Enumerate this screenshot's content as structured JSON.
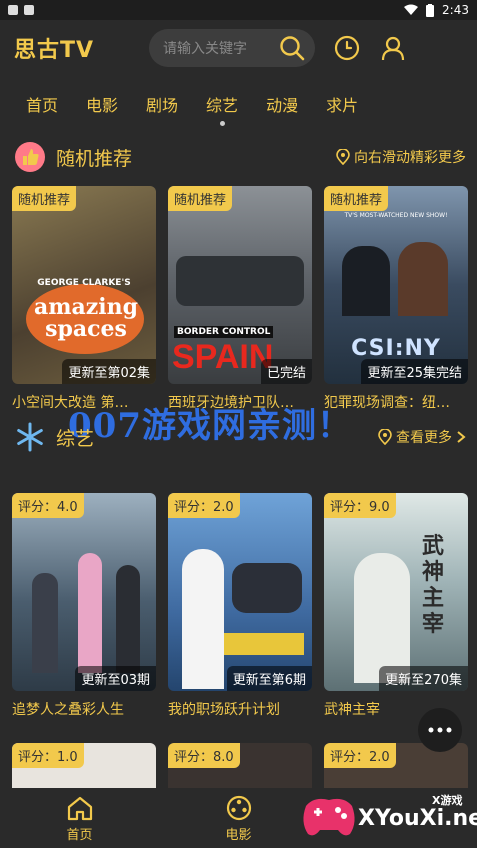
{
  "status_bar": {
    "time": "2:43"
  },
  "header": {
    "app_title": "思古TV",
    "search_placeholder": "请输入关键字"
  },
  "tabs": [
    {
      "label": "首页"
    },
    {
      "label": "电影"
    },
    {
      "label": "剧场"
    },
    {
      "label": "综艺"
    },
    {
      "label": "动漫"
    },
    {
      "label": "求片"
    }
  ],
  "random_section": {
    "title": "随机推荐",
    "more": "向右滑动精彩更多",
    "items": [
      {
        "badge": "随机推荐",
        "status": "更新至第02集",
        "title": "小空间大改造 第…",
        "poster_text": "amazing spaces",
        "poster_sub": "GEORGE CLARKE'S",
        "bg": "#6a5a3a"
      },
      {
        "badge": "随机推荐",
        "status": "已完结",
        "title": "西班牙边境护卫队…",
        "poster_text": "SPAIN",
        "poster_sub": "BORDER CONTROL",
        "bg": "#5b5f63"
      },
      {
        "badge": "随机推荐",
        "status": "更新至25集完结",
        "title": "犯罪现场调查：纽…",
        "poster_text": "CSI:NY",
        "poster_sub": "TV'S MOST-WATCHED NEW SHOW!",
        "bg": "#3b4a5a"
      }
    ]
  },
  "variety_section": {
    "title": "综艺",
    "more": "查看更多",
    "items": [
      {
        "badge": "评分：4.0",
        "status": "更新至03期",
        "title": "追梦人之叠彩人生",
        "bg": "#4a5d6e"
      },
      {
        "badge": "评分：2.0",
        "status": "更新至第6期",
        "title": "我的职场跃升计划",
        "bg": "#3f6aa0"
      },
      {
        "badge": "评分：9.0",
        "status": "更新至270集",
        "title": "武神主宰",
        "poster_text": "武神主宰",
        "bg": "#9fb3b6"
      }
    ]
  },
  "third_row": {
    "items": [
      {
        "badge": "评分：1.0",
        "bg": "#e8e4de"
      },
      {
        "badge": "评分：8.0",
        "bg": "#3a3330"
      },
      {
        "badge": "评分：2.0",
        "bg": "#4a3e36"
      }
    ]
  },
  "watermark": "007游戏网亲测！",
  "site_watermark": {
    "small": "X游戏",
    "big": "XYouXi.net"
  },
  "bottom_nav": [
    {
      "label": "首页"
    },
    {
      "label": "电影"
    },
    {
      "label": ""
    }
  ],
  "colors": {
    "accent": "#f2c94c",
    "bg": "#2a2a2a"
  }
}
